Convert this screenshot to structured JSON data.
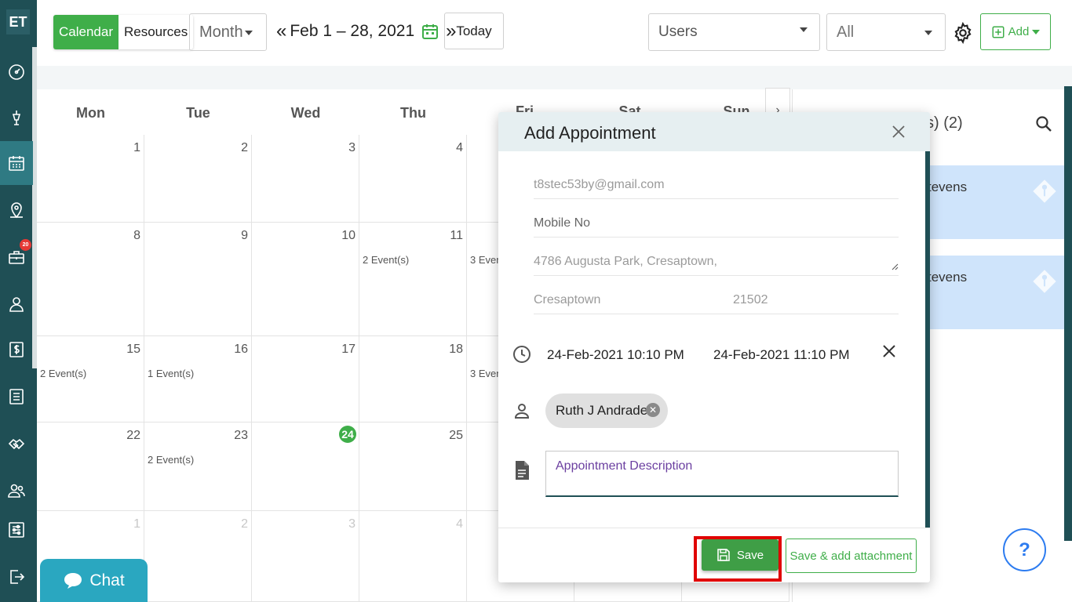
{
  "sidebar": {
    "logo": "ET",
    "badge_count": "20",
    "items": [
      {
        "icon": "dashboard-icon"
      },
      {
        "icon": "pen-tool-icon"
      },
      {
        "icon": "calendar-icon",
        "active": true
      },
      {
        "icon": "map-pin-icon"
      },
      {
        "icon": "briefcase-icon"
      },
      {
        "icon": "user-icon"
      },
      {
        "icon": "dollar-icon"
      },
      {
        "icon": "list-icon"
      },
      {
        "icon": "handshake-icon"
      },
      {
        "icon": "users-icon"
      },
      {
        "icon": "settings-sliders-icon"
      },
      {
        "icon": "logout-icon"
      }
    ]
  },
  "toolbar": {
    "calendar_label": "Calendar",
    "resources_label": "Resources",
    "view_select": "Month",
    "date_range": "Feb 1 – 28, 2021",
    "today_label": "Today",
    "users_select": "Users",
    "all_select": "All",
    "add_label": "Add"
  },
  "calendar": {
    "days": [
      "Mon",
      "Tue",
      "Wed",
      "Thu",
      "Fri",
      "Sat",
      "Sun"
    ],
    "rows": [
      [
        {
          "n": "1"
        },
        {
          "n": "2"
        },
        {
          "n": "3"
        },
        {
          "n": "4"
        }
      ],
      [
        {
          "n": "8"
        },
        {
          "n": "9"
        },
        {
          "n": "10"
        },
        {
          "n": "11",
          "ev": "2 Event(s)"
        },
        {
          "ev": "3 Even"
        }
      ],
      [
        {
          "n": "15",
          "ev": "2 Event(s)"
        },
        {
          "n": "16",
          "ev": "1 Event(s)"
        },
        {
          "n": "17"
        },
        {
          "n": "18"
        },
        {
          "ev": "3 Even"
        }
      ],
      [
        {
          "n": "22"
        },
        {
          "n": "23",
          "ev": "2 Event(s)"
        },
        {
          "n": "24",
          "today": true
        },
        {
          "n": "25"
        }
      ],
      [
        {
          "n": "1",
          "dim": true
        },
        {
          "n": "2",
          "dim": true
        },
        {
          "n": "3",
          "dim": true
        },
        {
          "n": "4",
          "dim": true
        }
      ]
    ],
    "next_arrow": "›",
    "partial_heads": [
      "Fri",
      "Sat",
      "Sun"
    ]
  },
  "right_panel": {
    "title_partial": "s) (2)",
    "cards": [
      "tevens",
      "tevens"
    ],
    "card_color": "#cfe4fb"
  },
  "modal": {
    "title": "Add Appointment",
    "email": "t8stec53by@gmail.com",
    "mobile_placeholder": "Mobile No",
    "address": "4786  Augusta Park, Cresaptown,",
    "city": "Cresaptown",
    "zip": "21502",
    "start_time": "24-Feb-2021 10:10 PM",
    "end_time": "24-Feb-2021 11:10 PM",
    "assignee": "Ruth J Andrade",
    "description_placeholder": "Appointment Description",
    "save_label": "Save",
    "save_attach_label": "Save & add attachment"
  },
  "chat_label": "Chat",
  "help_label": "?",
  "colors": {
    "sidebar": "#1f4f55",
    "accent_green": "#3fae49",
    "highlight_red": "#e00000"
  }
}
